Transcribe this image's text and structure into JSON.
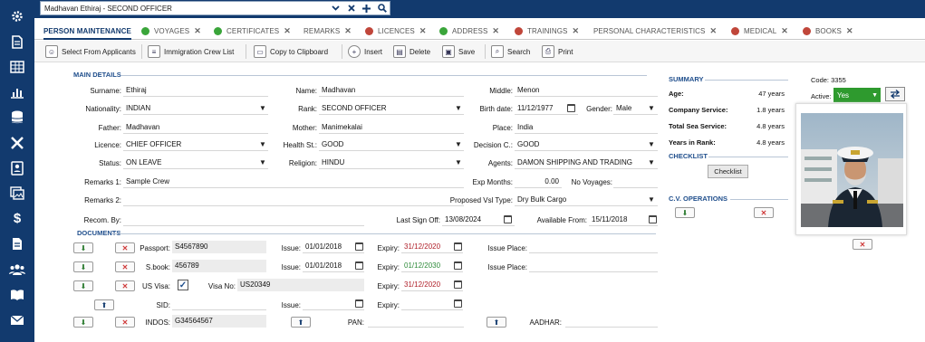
{
  "header": {
    "employee_value": "Madhavan Ethiraj - SECOND OFFICER"
  },
  "tabs": [
    {
      "label": "PERSON MAINTENANCE",
      "status": ""
    },
    {
      "label": "VOYAGES",
      "status": "#3aa53a"
    },
    {
      "label": "CERTIFICATES",
      "status": "#3aa53a"
    },
    {
      "label": "REMARKS",
      "status": ""
    },
    {
      "label": "LICENCES",
      "status": "#c0463a"
    },
    {
      "label": "ADDRESS",
      "status": "#3aa53a"
    },
    {
      "label": "TRAININGS",
      "status": "#c0463a"
    },
    {
      "label": "PERSONAL CHARACTERISTICS",
      "status": ""
    },
    {
      "label": "MEDICAL",
      "status": "#c0463a"
    },
    {
      "label": "BOOKS",
      "status": "#c0463a"
    }
  ],
  "toolbar": {
    "select_from_applicants": "Select From Applicants",
    "immigration_crew_list": "Immigration Crew List",
    "copy_to_clipboard": "Copy to Clipboard",
    "insert": "Insert",
    "delete": "Delete",
    "save": "Save",
    "search": "Search",
    "print": "Print"
  },
  "main_details": {
    "title": "MAIN DETAILS",
    "surname_label": "Surname:",
    "surname": "Ethiraj",
    "name_label": "Name:",
    "name": "Madhavan",
    "middle_label": "Middle:",
    "middle": "Menon",
    "nationality_label": "Nationality:",
    "nationality": "INDIAN",
    "rank_label": "Rank:",
    "rank": "SECOND OFFICER",
    "birth_label": "Birth date:",
    "birth": "11/12/1977",
    "gender_label": "Gender:",
    "gender": "Male",
    "father_label": "Father:",
    "father": "Madhavan",
    "mother_label": "Mother:",
    "mother": "Manimekalai",
    "place_label": "Place:",
    "place": "India",
    "licence_label": "Licence:",
    "licence": "CHIEF OFFICER",
    "health_label": "Health St.:",
    "health": "GOOD",
    "decision_label": "Decision C.:",
    "decision": "GOOD",
    "status_label": "Status:",
    "status": "ON LEAVE",
    "religion_label": "Religion:",
    "religion": "HINDU",
    "agents_label": "Agents:",
    "agents": "DAMON SHIPPING AND TRADING",
    "remarks1_label": "Remarks 1:",
    "remarks1": "Sample Crew",
    "exp_months_label": "Exp Months:",
    "exp_months": "0.00",
    "no_voyages_label": "No Voyages:",
    "remarks2_label": "Remarks 2:",
    "proposed_label": "Proposed Vsl Type:",
    "proposed": "Dry Bulk Cargo",
    "recom_label": "Recom. By:",
    "last_signoff_label": "Last Sign Off:",
    "last_signoff": "13/08/2024",
    "available_label": "Available From:",
    "available": "15/11/2018"
  },
  "documents": {
    "title": "DOCUMENTS",
    "passport_label": "Passport:",
    "passport": "S4567890",
    "passport_issue_label": "Issue:",
    "passport_issue": "01/01/2018",
    "passport_expiry_label": "Expiry:",
    "passport_expiry": "31/12/2020",
    "passport_place_label": "Issue Place:",
    "sbook_label": "S.book:",
    "sbook": "456789",
    "sbook_issue_label": "Issue:",
    "sbook_issue": "01/01/2018",
    "sbook_expiry_label": "Expiry:",
    "sbook_expiry": "01/12/2030",
    "sbook_place_label": "Issue Place:",
    "usvisa_label": "US Visa:",
    "visano_label": "Visa No:",
    "visano": "US20349",
    "visa_expiry_label": "Expiry:",
    "visa_expiry": "31/12/2020",
    "sid_label": "SID:",
    "sid_issue_label": "Issue:",
    "sid_expiry_label": "Expiry:",
    "indos_label": "INDOS:",
    "indos": "G34564567",
    "pan_label": "PAN:",
    "aadhar_label": "AADHAR:"
  },
  "summary": {
    "title": "SUMMARY",
    "age_label": "Age:",
    "age": "47 years",
    "company_label": "Company Service:",
    "company": "1.8 years",
    "sea_label": "Total Sea Service:",
    "sea": "4.8 years",
    "rank_label": "Years in Rank:",
    "rank": "4.8 years",
    "checklist_title": "CHECKLIST",
    "checklist_button": "Checklist",
    "cv_title": "C.V. OPERATIONS"
  },
  "profile": {
    "code": "Code: 3355",
    "active_label": "Active:",
    "active": "Yes"
  },
  "colors": {
    "sidebar": "#123a6e",
    "accent": "#1f4e8c",
    "active_green": "#2e9a2e"
  }
}
